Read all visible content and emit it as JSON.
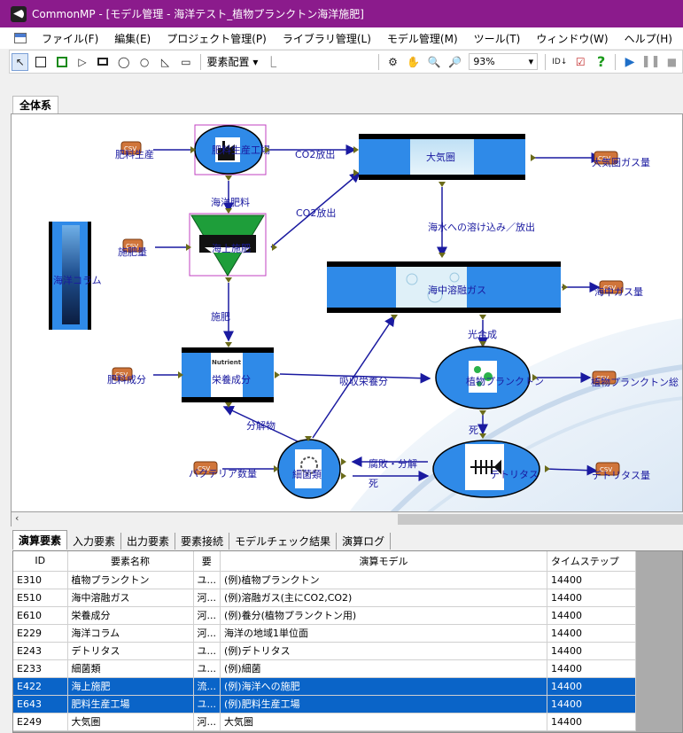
{
  "window": {
    "title": "CommonMP - [モデル管理 - 海洋テスト_植物プランクトン海洋施肥]"
  },
  "menu": [
    "ファイル(F)",
    "編集(E)",
    "プロジェクト管理(P)",
    "ライブラリ管理(L)",
    "モデル管理(M)",
    "ツール(T)",
    "ウィンドウ(W)",
    "ヘルプ(H)"
  ],
  "toolbar": {
    "layout_label": "要素配置 ▾",
    "zoom_value": "93%"
  },
  "canvas_tab": "全体系",
  "diagram": {
    "elements": {
      "fertilizer_factory": "肥料生産工場",
      "atmosphere": "大気圏",
      "ocean_fertilization": "海上施肥",
      "ocean_column": "海洋コラム",
      "dissolved_gas": "海中溶融ガス",
      "nutrients": "栄養成分",
      "phytoplankton": "植物プランクトン",
      "bacteria": "細菌類",
      "detritus": "デトリタス"
    },
    "outputs": {
      "fertilizer_production": "肥料生産",
      "fertilizer_amount": "施肥量",
      "fertilizer_component": "肥料成分",
      "atm_gas": "大気圏ガス量",
      "sea_gas": "海中ガス量",
      "plankton_out": "植物プランクトン総",
      "bacteria_amount": "バクテリア数量",
      "detritus_amount": "デトリタス量"
    },
    "flows": {
      "co2_release_1": "CO2放出",
      "ocean_fertilizer": "海洋肥料",
      "co2_release_2": "CO2放出",
      "dissolve_release": "海水への溶け込み／放出",
      "fertilize": "施肥",
      "photosynthesis": "光合成",
      "absorb_nutrients": "吸収栄養分",
      "decomposition": "分解物",
      "death_1": "死",
      "rot_decomp": "腐敗・分解",
      "death_2": "死"
    },
    "csv_badge": "CSV"
  },
  "bottom_tabs": [
    "演算要素",
    "入力要素",
    "出力要素",
    "要素接続",
    "モデルチェック結果",
    "演算ログ"
  ],
  "grid": {
    "headers": [
      "ID",
      "要素名称",
      "要",
      "演算モデル",
      "タイムステップ"
    ],
    "rows": [
      {
        "id": "E310",
        "name": "植物プランクトン",
        "kind": "ユ...",
        "model": "(例)植物プランクトン",
        "step": "14400",
        "selected": false
      },
      {
        "id": "E510",
        "name": "海中溶融ガス",
        "kind": "河...",
        "model": "(例)溶融ガス(主にCO2,CO2)",
        "step": "14400",
        "selected": false
      },
      {
        "id": "E610",
        "name": "栄養成分",
        "kind": "河...",
        "model": "(例)養分(植物プランクトン用)",
        "step": "14400",
        "selected": false
      },
      {
        "id": "E229",
        "name": "海洋コラム",
        "kind": "河...",
        "model": "海洋の地域1単位面",
        "step": "14400",
        "selected": false
      },
      {
        "id": "E243",
        "name": "デトリタス",
        "kind": "ユ...",
        "model": "(例)デトリタス",
        "step": "14400",
        "selected": false
      },
      {
        "id": "E233",
        "name": "細菌類",
        "kind": "ユ...",
        "model": "(例)細菌",
        "step": "14400",
        "selected": false
      },
      {
        "id": "E422",
        "name": "海上施肥",
        "kind": "流...",
        "model": "(例)海洋への施肥",
        "step": "14400",
        "selected": true
      },
      {
        "id": "E643",
        "name": "肥料生産工場",
        "kind": "ユ...",
        "model": "(例)肥料生産工場",
        "step": "14400",
        "selected": true
      },
      {
        "id": "E249",
        "name": "大気圏",
        "kind": "河...",
        "model": "大気圏",
        "step": "14400",
        "selected": false
      }
    ]
  }
}
